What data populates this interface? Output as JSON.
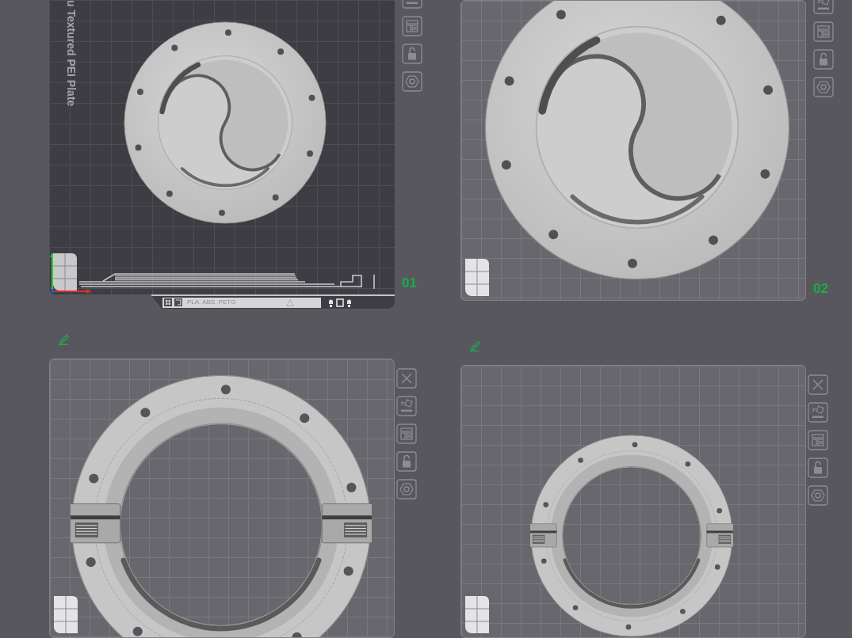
{
  "plates": [
    {
      "number": "01",
      "selected": true,
      "locked": false,
      "bed_label": "u Textured PEI Plate",
      "info_text": "PLA, ABS, PETG",
      "model": {
        "kind": "swirl-small"
      }
    },
    {
      "number": "02",
      "selected": false,
      "locked": false,
      "model": {
        "kind": "swirl-large"
      }
    },
    {
      "selected": false,
      "locked": false,
      "model": {
        "kind": "ring-large"
      }
    },
    {
      "selected": false,
      "locked": false,
      "model": {
        "kind": "ring-small"
      }
    }
  ]
}
